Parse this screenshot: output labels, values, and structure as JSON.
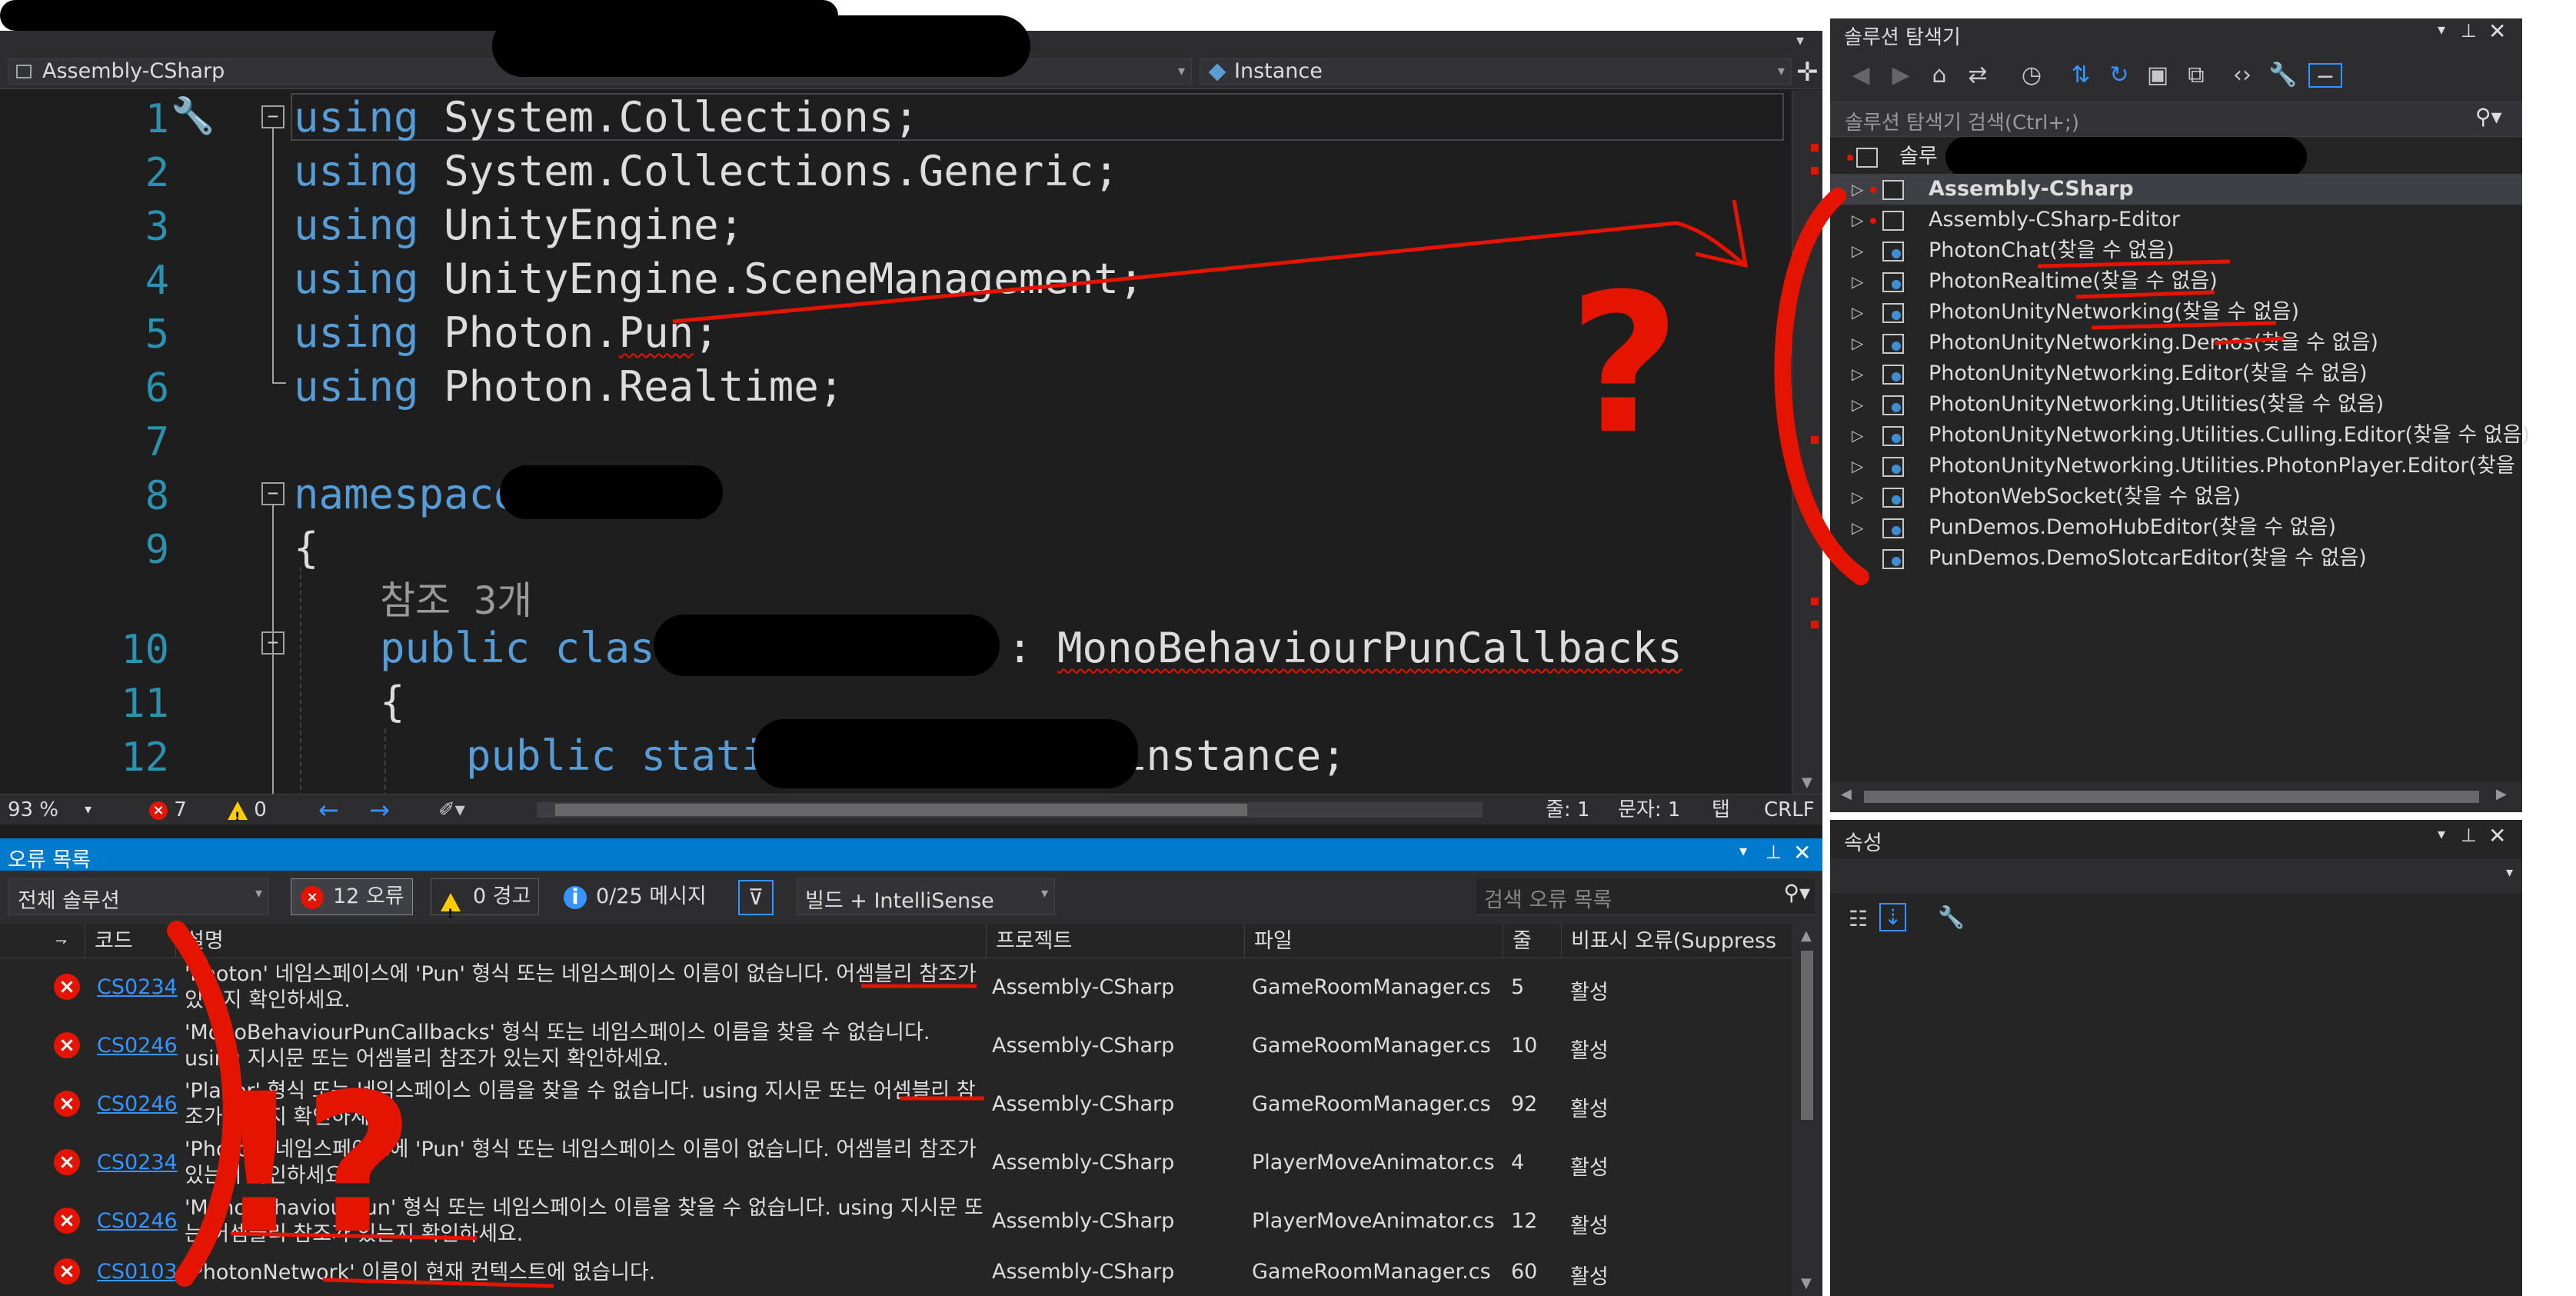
{
  "editor": {
    "project_combo": "Assembly-CSharp",
    "member_combo": "Instance",
    "lines": [
      {
        "n": "1",
        "kw": "using",
        "rest": " System.Collections;"
      },
      {
        "n": "2",
        "kw": "using",
        "rest": " System.Collections.Generic;"
      },
      {
        "n": "3",
        "kw": "using",
        "rest": " UnityEngine;"
      },
      {
        "n": "4",
        "kw": "using",
        "rest": " UnityEngine.SceneManagement;"
      },
      {
        "n": "5",
        "kw": "using",
        "rest": " Photon.Pun;"
      },
      {
        "n": "6",
        "kw": "using",
        "rest": " Photon.Realtime;"
      },
      {
        "n": "7"
      },
      {
        "n": "8",
        "kw": "namespace"
      },
      {
        "n": "9",
        "rest": "{"
      },
      {
        "n": "10",
        "kw": "public class",
        "base": "MonoBehaviourPunCallbacks"
      },
      {
        "n": "11",
        "rest": "{"
      },
      {
        "n": "12",
        "kw": "public static",
        "rest": "instance;"
      }
    ],
    "references_label": "참조 3개",
    "line5_prefix": " Photon.",
    "line5_squiggle": "Pun",
    "line5_suffix": ";",
    "line10_colon": ":"
  },
  "editor_status": {
    "zoom": "93 %",
    "errors": "7",
    "warnings": "0",
    "line": "줄: 1",
    "char": "문자: 1",
    "tab": "탭",
    "eol": "CRLF"
  },
  "solution_explorer": {
    "title": "솔루션 탐색기",
    "search_placeholder": "솔루션 탐색기 검색(Ctrl+;)",
    "root_prefix": "솔루",
    "items": [
      {
        "label": "Assembly-CSharp",
        "bold": true,
        "dot": true
      },
      {
        "label": "Assembly-CSharp-Editor",
        "dot": true
      },
      {
        "label": "PhotonChat(찾을 수 없음)"
      },
      {
        "label": "PhotonRealtime(찾을 수 없음)"
      },
      {
        "label": "PhotonUnityNetworking(찾을 수 없음)"
      },
      {
        "label": "PhotonUnityNetworking.Demos(찾을 수 없음)"
      },
      {
        "label": "PhotonUnityNetworking.Editor(찾을 수 없음)"
      },
      {
        "label": "PhotonUnityNetworking.Utilities(찾을 수 없음)"
      },
      {
        "label": "PhotonUnityNetworking.Utilities.Culling.Editor(찾을 수 없음)"
      },
      {
        "label": "PhotonUnityNetworking.Utilities.PhotonPlayer.Editor(찾을 수 없음)"
      },
      {
        "label": "PhotonWebSocket(찾을 수 없음)"
      },
      {
        "label": "PunDemos.DemoHubEditor(찾을 수 없음)"
      },
      {
        "label": "PunDemos.DemoSlotcarEditor(찾을 수 없음)",
        "no_arrow": true
      }
    ]
  },
  "properties": {
    "title": "속성"
  },
  "error_list": {
    "title": "오류 목록",
    "scope": "전체 솔루션",
    "errors_chip": "12 오류",
    "warnings_chip": "0 경고",
    "messages_chip": "0/25 메시지",
    "build_filter": "빌드 + IntelliSense",
    "search_placeholder": "검색 오류 목록",
    "columns": {
      "code": "코드",
      "desc": "설명",
      "project": "프로젝트",
      "file": "파일",
      "line": "줄",
      "suppression": "비표시 오류(Suppress"
    },
    "rows": [
      {
        "code": "CS0234",
        "desc": "'Photon' 네임스페이스에 'Pun' 형식 또는 네임스페이스 이름이 없습니다. 어셈블리 참조가 있는지 확인하세요.",
        "project": "Assembly-CSharp",
        "file": "GameRoomManager.cs",
        "line": "5",
        "state": "활성"
      },
      {
        "code": "CS0246",
        "desc": "'MonoBehaviourPunCallbacks' 형식 또는 네임스페이스 이름을 찾을 수 없습니다. using 지시문 또는 어셈블리 참조가 있는지 확인하세요.",
        "project": "Assembly-CSharp",
        "file": "GameRoomManager.cs",
        "line": "10",
        "state": "활성"
      },
      {
        "code": "CS0246",
        "desc": "'Player' 형식 또는 네임스페이스 이름을 찾을 수 없습니다. using 지시문 또는 어셈블리 참조가 있는지 확인하세요.",
        "project": "Assembly-CSharp",
        "file": "GameRoomManager.cs",
        "line": "92",
        "state": "활성"
      },
      {
        "code": "CS0234",
        "desc": "'Photon' 네임스페이스에 'Pun' 형식 또는 네임스페이스 이름이 없습니다. 어셈블리 참조가 있는지 확인하세요.",
        "project": "Assembly-CSharp",
        "file": "PlayerMoveAnimator.cs",
        "line": "4",
        "state": "활성"
      },
      {
        "code": "CS0246",
        "desc": "'MonoBehaviourPun' 형식 또는 네임스페이스 이름을 찾을 수 없습니다. using 지시문 또는 어셈블리 참조가 있는지 확인하세요.",
        "project": "Assembly-CSharp",
        "file": "PlayerMoveAnimator.cs",
        "line": "12",
        "state": "활성"
      },
      {
        "code": "CS0103",
        "desc": "'PhotonNetwork' 이름이 현재 컨텍스트에 없습니다.",
        "project": "Assembly-CSharp",
        "file": "GameRoomManager.cs",
        "line": "60",
        "state": "활성"
      }
    ]
  },
  "annotations": {
    "question_mark": "?",
    "exclaim": "!?",
    "color": "#e51400"
  }
}
